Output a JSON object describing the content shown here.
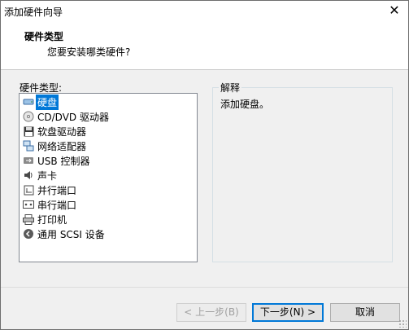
{
  "window": {
    "title": "添加硬件向导",
    "close_glyph": "✕"
  },
  "header": {
    "title": "硬件类型",
    "subtitle": "您要安装哪类硬件?"
  },
  "list": {
    "label": "硬件类型:",
    "items": [
      {
        "label": "硬盘",
        "icon": "hard-disk-icon",
        "selected": true
      },
      {
        "label": "CD/DVD 驱动器",
        "icon": "cd-dvd-icon"
      },
      {
        "label": "软盘驱动器",
        "icon": "floppy-icon"
      },
      {
        "label": "网络适配器",
        "icon": "network-adapter-icon"
      },
      {
        "label": "USB 控制器",
        "icon": "usb-icon"
      },
      {
        "label": "声卡",
        "icon": "sound-card-icon"
      },
      {
        "label": "并行端口",
        "icon": "parallel-port-icon"
      },
      {
        "label": "串行端口",
        "icon": "serial-port-icon"
      },
      {
        "label": "打印机",
        "icon": "printer-icon"
      },
      {
        "label": "通用 SCSI 设备",
        "icon": "scsi-icon"
      }
    ]
  },
  "explanation": {
    "label": "解释",
    "text": "添加硬盘。"
  },
  "buttons": {
    "back": "< 上一步(B)",
    "next": "下一步(N) >",
    "cancel": "取消"
  },
  "colors": {
    "selection": "#0078d7"
  }
}
